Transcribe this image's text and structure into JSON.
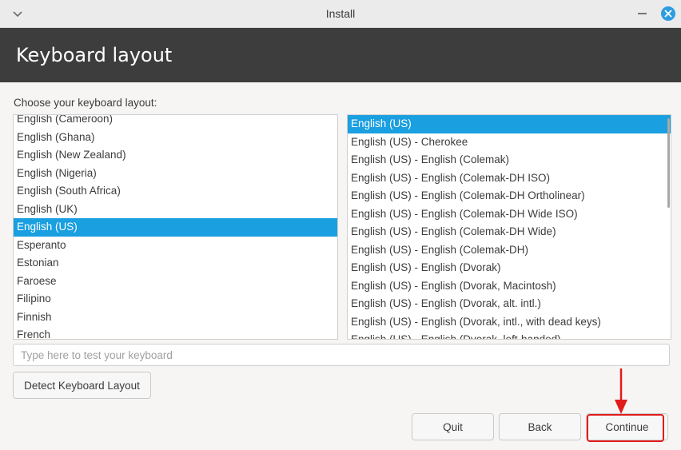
{
  "window": {
    "title": "Install"
  },
  "header": {
    "heading": "Keyboard layout"
  },
  "prompt": "Choose your keyboard layout:",
  "layouts": {
    "items": [
      "English (Cameroon)",
      "English (Ghana)",
      "English (New Zealand)",
      "English (Nigeria)",
      "English (South Africa)",
      "English (UK)",
      "English (US)",
      "Esperanto",
      "Estonian",
      "Faroese",
      "Filipino",
      "Finnish",
      "French"
    ],
    "selected": "English (US)"
  },
  "variants": {
    "items": [
      "English (US)",
      "English (US) - Cherokee",
      "English (US) - English (Colemak)",
      "English (US) - English (Colemak-DH ISO)",
      "English (US) - English (Colemak-DH Ortholinear)",
      "English (US) - English (Colemak-DH Wide ISO)",
      "English (US) - English (Colemak-DH Wide)",
      "English (US) - English (Colemak-DH)",
      "English (US) - English (Dvorak)",
      "English (US) - English (Dvorak, Macintosh)",
      "English (US) - English (Dvorak, alt. intl.)",
      "English (US) - English (Dvorak, intl., with dead keys)",
      "English (US) - English (Dvorak, left-handed)"
    ],
    "selected": "English (US)"
  },
  "test_input": {
    "placeholder": "Type here to test your keyboard",
    "value": ""
  },
  "buttons": {
    "detect": "Detect Keyboard Layout",
    "quit": "Quit",
    "back": "Back",
    "continue": "Continue"
  },
  "colors": {
    "selection": "#1a9fe0",
    "header_bg": "#3d3d3d",
    "annotation": "#e21b1b",
    "close_button": "#2d9ce0"
  },
  "icons": {
    "window_menu": "chevron-down-icon",
    "minimize": "minimize-icon",
    "close": "close-icon",
    "annotation": "arrow-down-icon"
  }
}
